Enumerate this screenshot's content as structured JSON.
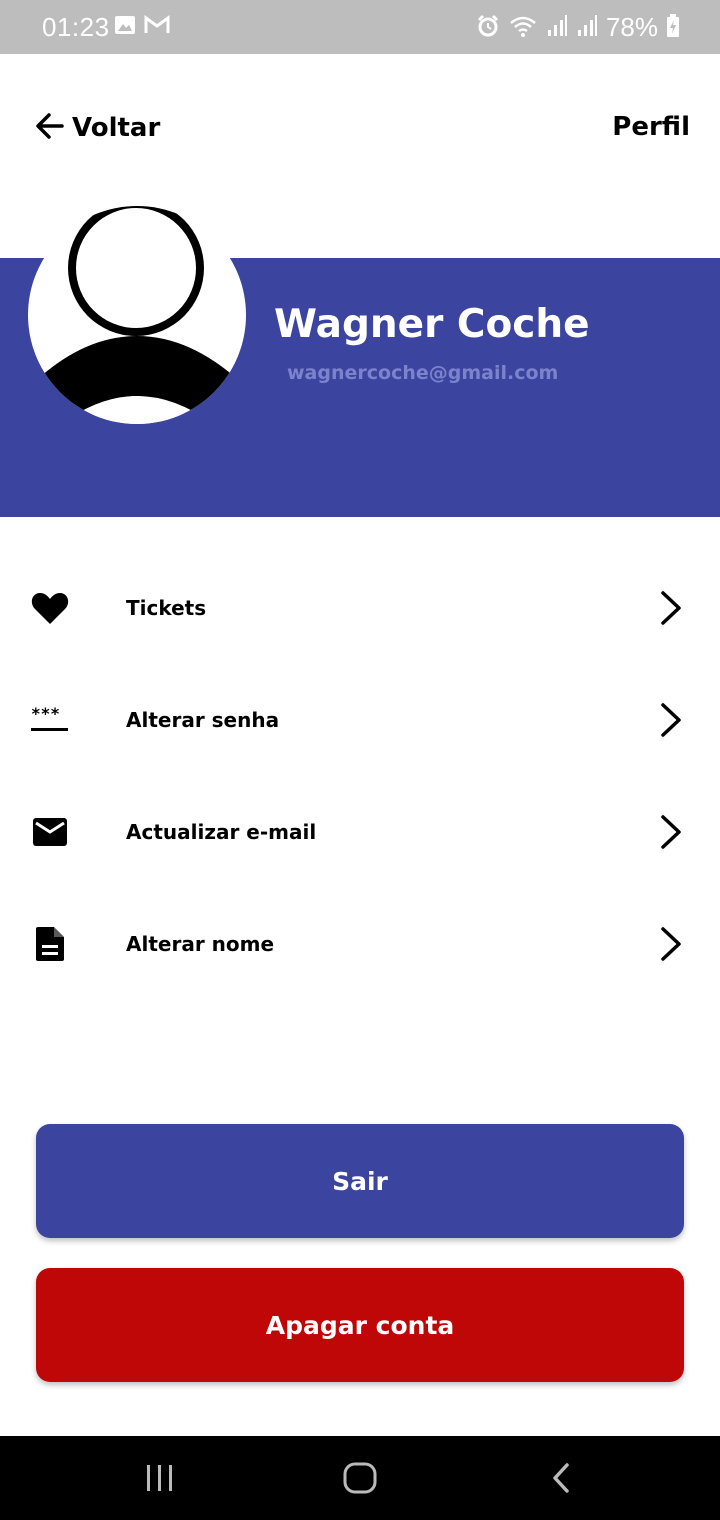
{
  "status_bar": {
    "time": "01:23",
    "battery": "78%",
    "icons": [
      "image-icon",
      "gmail-icon",
      "alarm-icon",
      "wifi-icon",
      "signal-icon",
      "signal-icon",
      "battery-charging-icon"
    ]
  },
  "header": {
    "back_label": "Voltar",
    "title": "Perfil"
  },
  "profile": {
    "name": "Wagner Coche",
    "email": "wagnercoche@gmail.com",
    "avatar_icon": "user-placeholder-icon"
  },
  "menu": {
    "items": [
      {
        "label": "Tickets",
        "icon": "heart-icon"
      },
      {
        "label": "Alterar senha",
        "icon": "password-icon"
      },
      {
        "label": "Actualizar e-mail",
        "icon": "mail-icon"
      },
      {
        "label": "Alterar nome",
        "icon": "document-icon"
      }
    ]
  },
  "actions": {
    "logout_label": "Sair",
    "delete_label": "Apagar conta"
  },
  "colors": {
    "primary": "#3b449e",
    "danger": "#bf0707",
    "email_text": "#7a84cc"
  }
}
